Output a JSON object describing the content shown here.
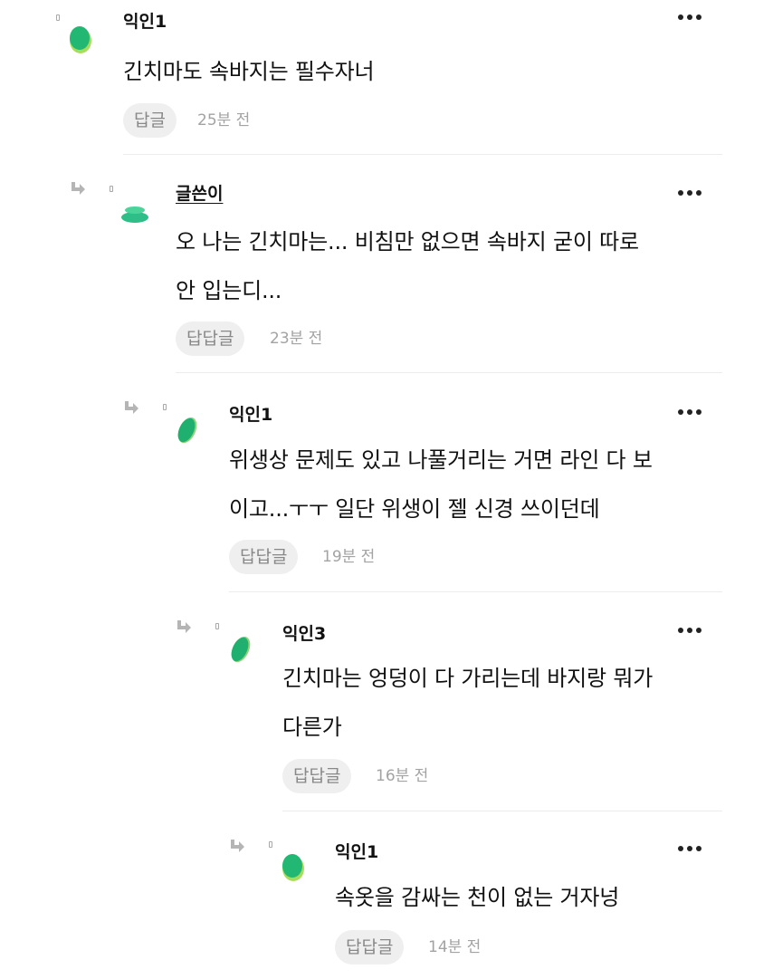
{
  "comments": [
    {
      "author": "익인1",
      "is_writer": false,
      "lines": [
        "긴치마도 속바지는 필수자너"
      ],
      "reply_label": "답글",
      "time": "25분 전",
      "avatar_color": "#2fc078",
      "avatar_icon": "green-blob-avatar-icon"
    },
    {
      "author": "글쓴이",
      "is_writer": true,
      "lines": [
        "오 나는 긴치마는... 비침만 없으면 속바지 굳이 따로",
        "안 입는디..."
      ],
      "reply_label": "답답글",
      "time": "23분 전",
      "avatar_color": "#3ec98c",
      "avatar_icon": "green-blob-avatar-icon"
    },
    {
      "author": "익인1",
      "is_writer": false,
      "lines": [
        "위생상 문제도 있고 나풀거리는 거면 라인 다 보",
        "이고...ㅜㅜ 일단 위생이 젤 신경 쓰이던데"
      ],
      "reply_label": "답답글",
      "time": "19분 전",
      "avatar_color": "#2fc078",
      "avatar_icon": "green-blob-avatar-icon"
    },
    {
      "author": "익인3",
      "is_writer": false,
      "lines": [
        "긴치마는 엉덩이 다 가리는데 바지랑 뭐가",
        "다른가"
      ],
      "reply_label": "답답글",
      "time": "16분 전",
      "avatar_color": "#2fc078",
      "avatar_icon": "green-blob-avatar-icon"
    },
    {
      "author": "익인1",
      "is_writer": false,
      "lines": [
        "속옷을 감싸는 천이 없는 거자넝"
      ],
      "reply_label": "답답글",
      "time": "14분 전",
      "avatar_color": "#2fc078",
      "avatar_icon": "green-blob-avatar-icon"
    }
  ],
  "colors": {
    "accent_green": "#2fc078",
    "reply_button_bg": "#efefef",
    "muted_text": "#a3a3a3"
  }
}
